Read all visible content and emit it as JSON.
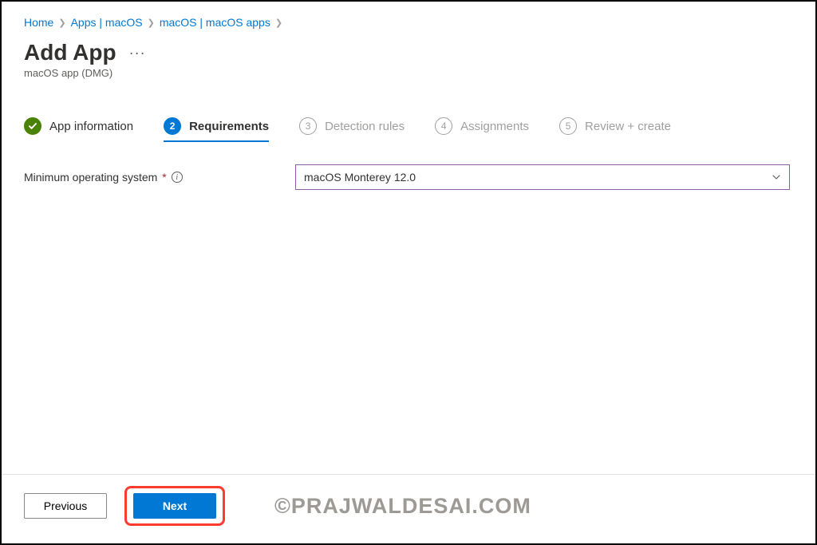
{
  "breadcrumb": {
    "home": "Home",
    "apps": "Apps | macOS",
    "macos": "macOS | macOS apps"
  },
  "header": {
    "title": "Add App",
    "subtitle": "macOS app (DMG)"
  },
  "steps": {
    "s1": {
      "label": "App information"
    },
    "s2": {
      "num": "2",
      "label": "Requirements"
    },
    "s3": {
      "num": "3",
      "label": "Detection rules"
    },
    "s4": {
      "num": "4",
      "label": "Assignments"
    },
    "s5": {
      "num": "5",
      "label": "Review + create"
    }
  },
  "form": {
    "min_os_label": "Minimum operating system",
    "min_os_value": "macOS Monterey 12.0"
  },
  "buttons": {
    "previous": "Previous",
    "next": "Next"
  },
  "watermark": "©PRAJWALDESAI.COM"
}
